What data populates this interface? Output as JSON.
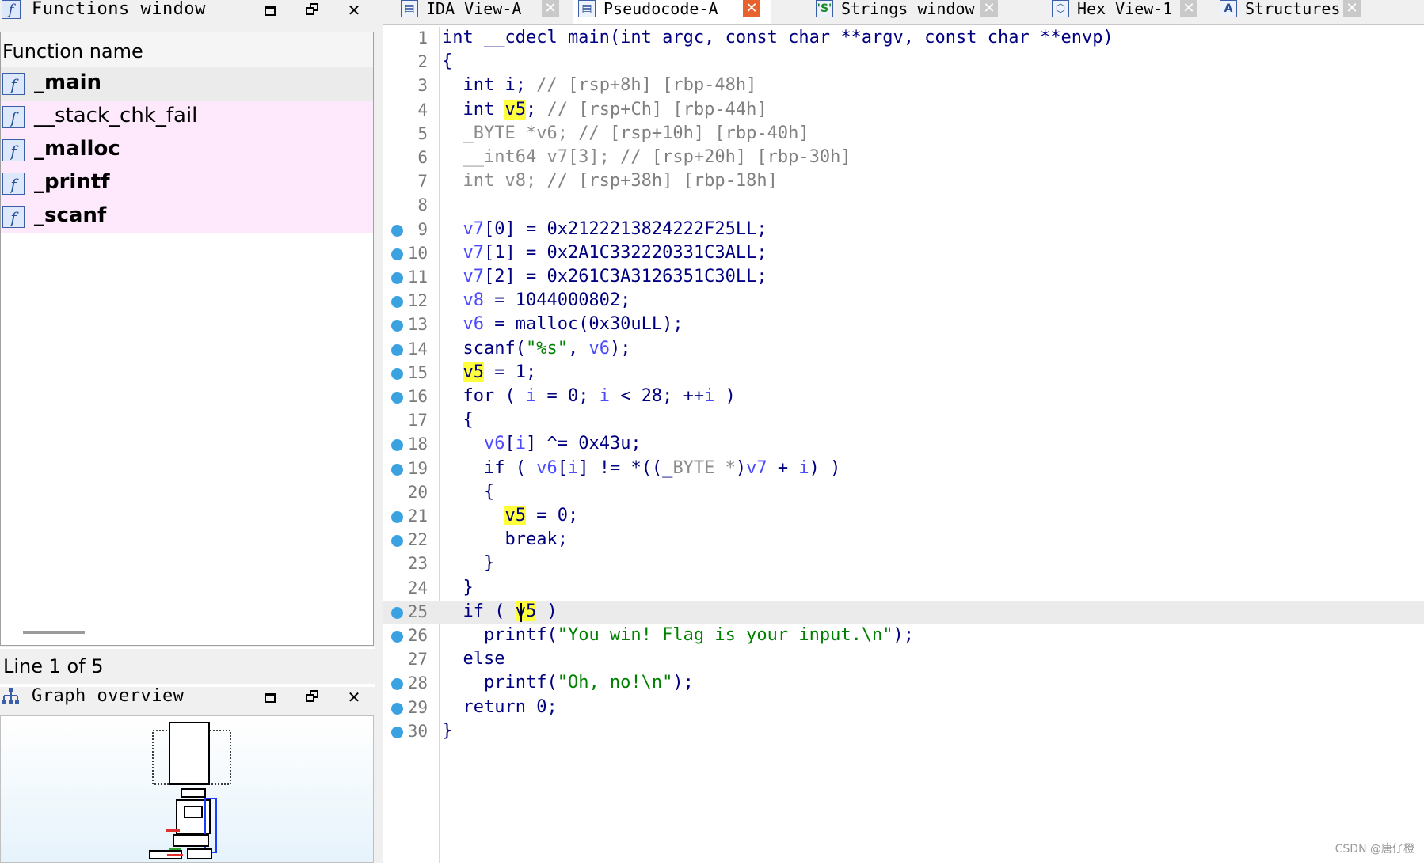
{
  "functions_window": {
    "title": "Functions window",
    "column_header": "Function name",
    "items": [
      {
        "name": "_main",
        "bold": true,
        "bg": "#ebebeb"
      },
      {
        "name": "__stack_chk_fail",
        "bold": false,
        "bg": "#fde9fb"
      },
      {
        "name": "_malloc",
        "bold": true,
        "bg": "#fde9fb"
      },
      {
        "name": "_printf",
        "bold": true,
        "bg": "#fde9fb"
      },
      {
        "name": "_scanf",
        "bold": true,
        "bg": "#fde9fb"
      }
    ],
    "status": "Line 1 of 5"
  },
  "graph_overview": {
    "title": "Graph overview"
  },
  "tabs": [
    {
      "label": "IDA View-A",
      "icon": "ida-view-icon",
      "active": false
    },
    {
      "label": "Pseudocode-A",
      "icon": "pseudocode-icon",
      "active": true
    },
    {
      "label": "Strings window",
      "icon": "strings-icon",
      "icon_text": "'S'",
      "active": false
    },
    {
      "label": "Hex View-1",
      "icon": "hex-icon",
      "active": false
    },
    {
      "label": "Structures",
      "icon": "structures-icon",
      "icon_text": "A",
      "active": false
    }
  ],
  "code": {
    "current_line": 25,
    "lines": [
      {
        "n": "1",
        "bp": false
      },
      {
        "n": "2",
        "bp": false
      },
      {
        "n": "3",
        "bp": false
      },
      {
        "n": "4",
        "bp": false
      },
      {
        "n": "5",
        "bp": false
      },
      {
        "n": "6",
        "bp": false
      },
      {
        "n": "7",
        "bp": false
      },
      {
        "n": "8",
        "bp": false
      },
      {
        "n": "9",
        "bp": true
      },
      {
        "n": "10",
        "bp": true
      },
      {
        "n": "11",
        "bp": true
      },
      {
        "n": "12",
        "bp": true
      },
      {
        "n": "13",
        "bp": true
      },
      {
        "n": "14",
        "bp": true
      },
      {
        "n": "15",
        "bp": true
      },
      {
        "n": "16",
        "bp": true
      },
      {
        "n": "17",
        "bp": false
      },
      {
        "n": "18",
        "bp": true
      },
      {
        "n": "19",
        "bp": true
      },
      {
        "n": "20",
        "bp": false
      },
      {
        "n": "21",
        "bp": true
      },
      {
        "n": "22",
        "bp": true
      },
      {
        "n": "23",
        "bp": false
      },
      {
        "n": "24",
        "bp": false
      },
      {
        "n": "25",
        "bp": true
      },
      {
        "n": "26",
        "bp": true
      },
      {
        "n": "27",
        "bp": false
      },
      {
        "n": "28",
        "bp": true
      },
      {
        "n": "29",
        "bp": true
      },
      {
        "n": "30",
        "bp": true
      }
    ],
    "tokens": [
      [
        [
          "k",
          "int __cdecl main(int argc, const char **argv, const char **envp)"
        ]
      ],
      [
        [
          "k",
          "{"
        ]
      ],
      [
        [
          "k",
          "  int i; "
        ],
        [
          "g",
          "// [rsp+8h] [rbp-48h]"
        ]
      ],
      [
        [
          "k",
          "  int "
        ],
        [
          "hl",
          "v5"
        ],
        [
          "k",
          "; "
        ],
        [
          "g",
          "// [rsp+Ch] [rbp-44h]"
        ]
      ],
      [
        [
          "grey",
          "  _BYTE *v6; "
        ],
        [
          "g",
          "// [rsp+10h] [rbp-40h]"
        ]
      ],
      [
        [
          "grey",
          "  __int64 v7[3]; "
        ],
        [
          "g",
          "// [rsp+20h] [rbp-30h]"
        ]
      ],
      [
        [
          "grey",
          "  int v8; "
        ],
        [
          "g",
          "// [rsp+38h] [rbp-18h]"
        ]
      ],
      [
        [
          "k",
          ""
        ]
      ],
      [
        [
          "var",
          "  v7"
        ],
        [
          "k",
          "[0] = 0x2122213824222F25LL;"
        ]
      ],
      [
        [
          "var",
          "  v7"
        ],
        [
          "k",
          "[1] = 0x2A1C332220331C3ALL;"
        ]
      ],
      [
        [
          "var",
          "  v7"
        ],
        [
          "k",
          "[2] = 0x261C3A3126351C30LL;"
        ]
      ],
      [
        [
          "var",
          "  v8"
        ],
        [
          "k",
          " = 1044000802;"
        ]
      ],
      [
        [
          "var",
          "  v6"
        ],
        [
          "k",
          " = malloc(0x30uLL);"
        ]
      ],
      [
        [
          "k",
          "  scanf("
        ],
        [
          "str",
          "\"%s\""
        ],
        [
          "k",
          ", "
        ],
        [
          "var",
          "v6"
        ],
        [
          "k",
          ");"
        ]
      ],
      [
        [
          "k",
          "  "
        ],
        [
          "hl",
          "v5"
        ],
        [
          "k",
          " = 1;"
        ]
      ],
      [
        [
          "k",
          "  for ( "
        ],
        [
          "var",
          "i"
        ],
        [
          "k",
          " = 0; "
        ],
        [
          "var",
          "i"
        ],
        [
          "k",
          " < 28; ++"
        ],
        [
          "var",
          "i"
        ],
        [
          "k",
          " )"
        ]
      ],
      [
        [
          "k",
          "  {"
        ]
      ],
      [
        [
          "var",
          "    v6"
        ],
        [
          "k",
          "["
        ],
        [
          "var",
          "i"
        ],
        [
          "k",
          "] ^= 0x43u;"
        ]
      ],
      [
        [
          "k",
          "    if ( "
        ],
        [
          "var",
          "v6"
        ],
        [
          "k",
          "["
        ],
        [
          "var",
          "i"
        ],
        [
          "k",
          "] != *((_"
        ],
        [
          "grey",
          "BYTE *"
        ],
        [
          "k",
          ")"
        ],
        [
          "var",
          "v7"
        ],
        [
          "k",
          " + "
        ],
        [
          "var",
          "i"
        ],
        [
          "k",
          ") )"
        ]
      ],
      [
        [
          "k",
          "    {"
        ]
      ],
      [
        [
          "k",
          "      "
        ],
        [
          "hl",
          "v5"
        ],
        [
          "k",
          " = 0;"
        ]
      ],
      [
        [
          "k",
          "      break;"
        ]
      ],
      [
        [
          "k",
          "    }"
        ]
      ],
      [
        [
          "k",
          "  }"
        ]
      ],
      [
        [
          "k",
          "  if ( "
        ],
        [
          "hl",
          "v5"
        ],
        [
          "k",
          " )"
        ]
      ],
      [
        [
          "k",
          "    printf("
        ],
        [
          "str",
          "\"You win! Flag is your input.\\n\""
        ],
        [
          "k",
          ");"
        ]
      ],
      [
        [
          "k",
          "  else"
        ]
      ],
      [
        [
          "k",
          "    printf("
        ],
        [
          "str",
          "\"Oh, no!\\n\""
        ],
        [
          "k",
          ");"
        ]
      ],
      [
        [
          "k",
          "  return 0;"
        ]
      ],
      [
        [
          "k",
          "}"
        ]
      ]
    ]
  },
  "watermark": "CSDN @唐仔橙"
}
